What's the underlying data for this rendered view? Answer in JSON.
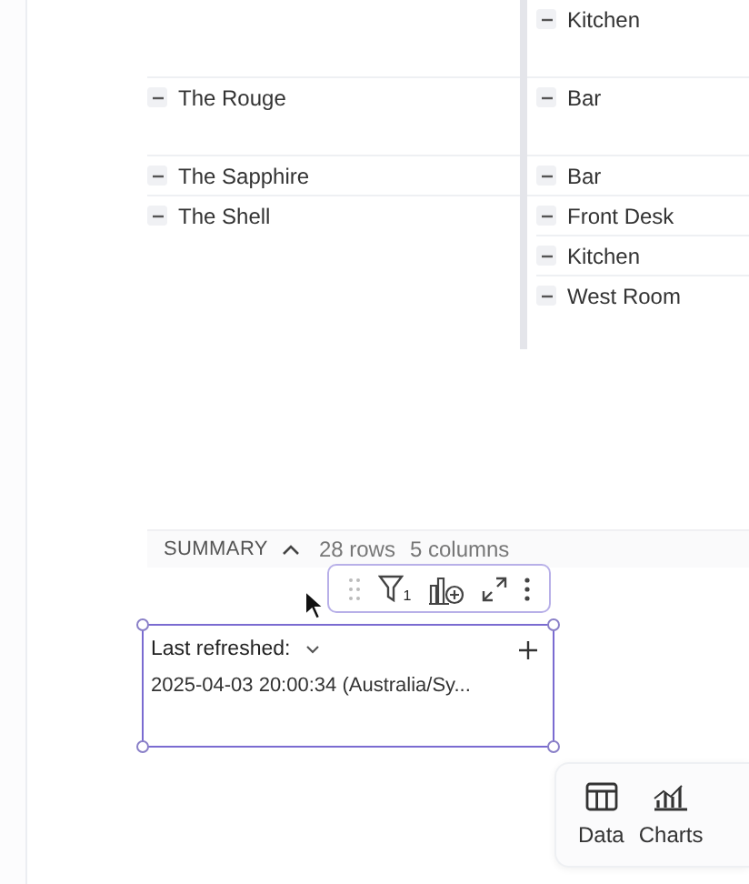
{
  "table": {
    "groups": [
      {
        "children": [
          {
            "label": "Kitchen",
            "expanded": true
          }
        ]
      },
      {
        "label": "The Rouge",
        "expanded": true,
        "children": [
          {
            "label": "Bar",
            "expanded": true
          }
        ]
      },
      {
        "label": "The Sapphire",
        "expanded": true,
        "children": [
          {
            "label": "Bar",
            "expanded": true
          }
        ]
      },
      {
        "label": "The Shell",
        "expanded": true,
        "children": [
          {
            "label": "Front Desk",
            "expanded": true
          },
          {
            "label": "Kitchen",
            "expanded": true
          },
          {
            "label": "West Room",
            "expanded": true
          }
        ]
      }
    ]
  },
  "summary": {
    "title": "SUMMARY",
    "expanded": true,
    "rows": "28 rows",
    "columns": "5 columns"
  },
  "card": {
    "label": "Last refreshed:",
    "value": "2025-04-03 20:00:34 (Australia/Sy...",
    "selected": true,
    "toolbar": {
      "filter_count": "1"
    }
  },
  "nav": [
    {
      "label": "Data",
      "kind": "data"
    },
    {
      "label": "Charts",
      "kind": "charts"
    }
  ]
}
